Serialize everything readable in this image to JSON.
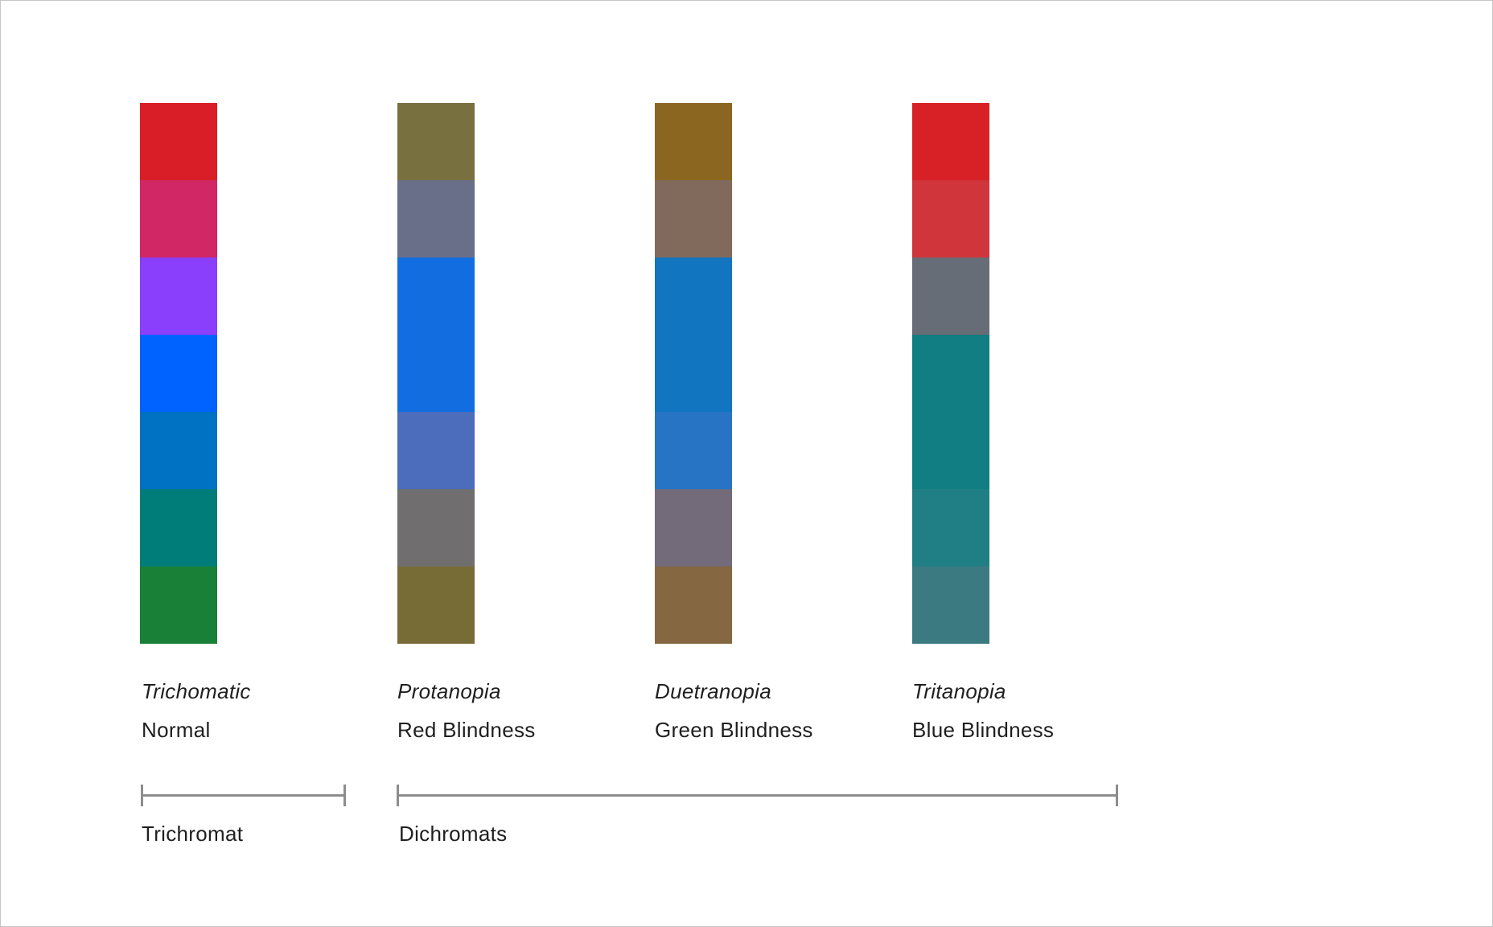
{
  "columns": [
    {
      "name": "Trichomatic",
      "description": "Normal",
      "swatches": [
        "#da1e28",
        "#d12765",
        "#8a3ffc",
        "#0062ff",
        "#0072c3",
        "#007d79",
        "#198038"
      ]
    },
    {
      "name": "Protanopia",
      "description": "Red Blindness",
      "swatches": [
        "#79703f",
        "#6a6f89",
        "#126ee0",
        "#126ee0",
        "#4c6cbc",
        "#706e6f",
        "#786c36"
      ]
    },
    {
      "name": "Duetranopia",
      "description": "Green Blindness",
      "swatches": [
        "#8a6620",
        "#816a5c",
        "#1175bf",
        "#1175bf",
        "#2874c4",
        "#736a7a",
        "#856841"
      ]
    },
    {
      "name": "Tritanopia",
      "description": "Blue Blindness",
      "swatches": [
        "#d82127",
        "#cf353b",
        "#676d76",
        "#107e82",
        "#107e82",
        "#207f85",
        "#3c7a82"
      ]
    }
  ],
  "groups": [
    {
      "label": "Trichromat"
    },
    {
      "label": "Dichromats"
    }
  ],
  "colors": {
    "bracket": "#8d8d8d",
    "border": "#c6c6c6",
    "text": "#1f1f1f"
  }
}
